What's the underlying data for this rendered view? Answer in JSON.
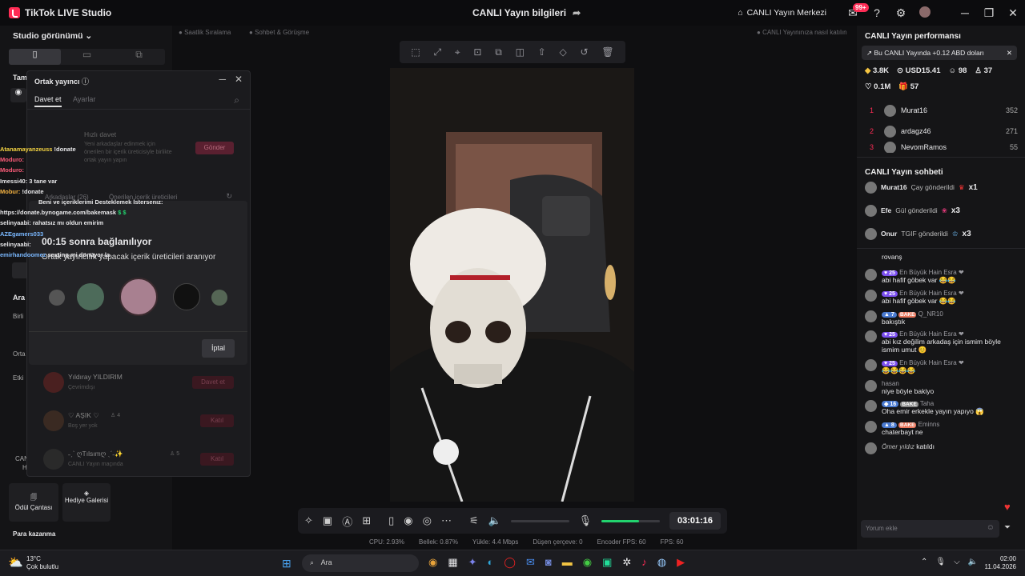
{
  "app": {
    "title": "TikTok LIVE Studio",
    "center_title": "CANLI Yayın bilgileri",
    "center_label": "CANLI Yayın Merkezi",
    "notif_count": "99+"
  },
  "left": {
    "studio_view": "Studio görünümü",
    "tam": "Tam",
    "ara": "Ara",
    "birli": "Birli",
    "orta": "Orta",
    "etki": "Etki",
    "canl": "CANL",
    "h": "H",
    "reward_bag": "Ödül Çantası",
    "gift_gallery": "Hediye Galerisi",
    "money": "Para kazanma"
  },
  "main_top": {
    "item1": "Saatlik Sıralama",
    "item2": "Sohbet & Görüşme",
    "item3": "CANLI Yayınınıza nasıl katılın"
  },
  "dialog": {
    "title": "Ortak yayıncı",
    "tab_invite": "Davet et",
    "tab_settings": "Ayarlar",
    "quick_invite": "Hızlı davet",
    "quick_desc": "Yeni arkadaşlar edinmek için önerilen bir içerik üreticisiyle birlikte ortak yayın yapın",
    "send": "Gönder",
    "friends_tab": "Arkadaşlar (26)",
    "suggested_tab": "Önerilen içerik üreticileri",
    "rows": [
      {
        "name": "Yıldıray YILDIRIM",
        "status": "Çevrimdışı",
        "action": "Davet et"
      },
      {
        "name": "♡ AŞIK ♡",
        "status": "Boş yer yok",
        "count": "4",
        "action": "Katıl"
      },
      {
        "name": "˗ˏˋ ღTılsımღ ˎˊ˗✨",
        "status": "CANLI Yayın maçında",
        "count": "5",
        "action": "Katıl"
      }
    ]
  },
  "popup": {
    "countdown": "00:15 sonra bağlanılıyor",
    "searching": "Ortak yayıncılık yapacak içerik üreticileri aranıyor",
    "cancel": "İptal"
  },
  "overlay_chat": [
    {
      "name": "Atanamayanzeuss",
      "text": "!donate",
      "color": "#f5d442"
    },
    {
      "name": "Moduro:",
      "text": "",
      "color": "#ff5d7a"
    },
    {
      "name": "Moduro:",
      "text": "",
      "color": "#ff5d7a"
    },
    {
      "name": "Imessi40:",
      "text": "3 tane var",
      "color": "#ffffff"
    },
    {
      "name": "Mobur:",
      "text": "!donate",
      "color": "#f5b342"
    },
    {
      "name": "",
      "text": "Beni ve içeriklerimi Desteklemek İstersenız:",
      "color": "#ffffff"
    },
    {
      "name": "",
      "text": "https://donate.bynogame.com/bakemask",
      "color": "#ffffff"
    },
    {
      "name": "selinyaabi:",
      "text": "rahatsız mı oldun emirim",
      "color": "#ffffff"
    },
    {
      "name": "AZEgamers033",
      "text": "",
      "color": "#7ab8ff"
    },
    {
      "name": "selinyaabi:",
      "text": "",
      "color": "#ffffff"
    },
    {
      "name": "emirhandoomez",
      "text": "sexting mi dönüyor la",
      "color": "#7ab8ff"
    }
  ],
  "toolbar_icons": [
    "select-icon",
    "expand-icon",
    "crosshair-icon",
    "crop-icon",
    "copy-icon",
    "mirror-icon",
    "upload-icon",
    "layers-icon",
    "rotate-icon",
    "delete-icon"
  ],
  "controls": {
    "timer": "03:01:16"
  },
  "status": {
    "cpu": "CPU: 2.93%",
    "memory": "Bellek: 0.87%",
    "upload": "Yükle: 4.4 Mbps",
    "dropped": "Düşen çerçeve: 0",
    "encoder": "Encoder FPS: 60",
    "fps": "FPS: 60"
  },
  "right": {
    "perf_title": "CANLI Yayın performansı",
    "earning": "Bu CANLI Yayında +0.12 ABD doları",
    "stats": [
      "3.8K",
      "USD15.41",
      "98",
      "37",
      "0.1M",
      "57"
    ],
    "ranking": [
      {
        "rank": "1",
        "name": "Murat16",
        "score": "352"
      },
      {
        "rank": "2",
        "name": "ardagz46",
        "score": "271"
      },
      {
        "rank": "3",
        "name": "NevomRamos",
        "score": "55"
      }
    ],
    "chat_title": "CANLI Yayın sohbeti",
    "gifts": [
      {
        "name": "Murat16",
        "text": "Çay gönderildi",
        "mult": "x1"
      },
      {
        "name": "Efe",
        "text": "Gül gönderildi",
        "mult": "x3"
      },
      {
        "name": "Onur",
        "text": "TGIF gönderildi",
        "mult": "x3"
      }
    ],
    "messages": [
      {
        "level": "",
        "badge": "",
        "user": "",
        "text": "rovanş"
      },
      {
        "level": "25",
        "badge": "",
        "user": "En Büyük Hain Esra ❤",
        "text": "abi hafif göbek var 😂😂"
      },
      {
        "level": "25",
        "badge": "",
        "user": "En Büyük Hain Esra ❤",
        "text": "abi hafif göbek var 😂😂"
      },
      {
        "level": "7",
        "badge": "BAKE",
        "user": "Q_NR10",
        "text": "bakıştık"
      },
      {
        "level": "25",
        "badge": "",
        "user": "En Büyük Hain Esra ❤",
        "text": "abi kız değilim arkadaş için ismim böyle ismim umut 😊"
      },
      {
        "level": "25",
        "badge": "",
        "user": "En Büyük Hain Esra ❤",
        "text": "😂😂😂😂"
      },
      {
        "level": "",
        "badge": "",
        "user": "hasan",
        "text": "niye böyle bakiyo"
      },
      {
        "level": "16",
        "badge": "BAKE",
        "user": "Taha",
        "text": "Oha emir erkekle yayın yapıyo 😱"
      },
      {
        "level": "8",
        "badge": "BAKE",
        "user": "Eminns",
        "text": "chaterbayt ne"
      },
      {
        "level": "",
        "badge": "",
        "user": "Ömer yıldız",
        "text": "katıldı"
      }
    ],
    "comment_placeholder": "Yorum ekle"
  },
  "taskbar": {
    "temp": "13°C",
    "weather": "Çok bulutlu",
    "search": "Ara",
    "time": "02:00",
    "date": "11.04.2026"
  },
  "colors": {
    "accent": "#fe2c55",
    "purple": "#7b4ff0",
    "green": "#22d36e"
  }
}
